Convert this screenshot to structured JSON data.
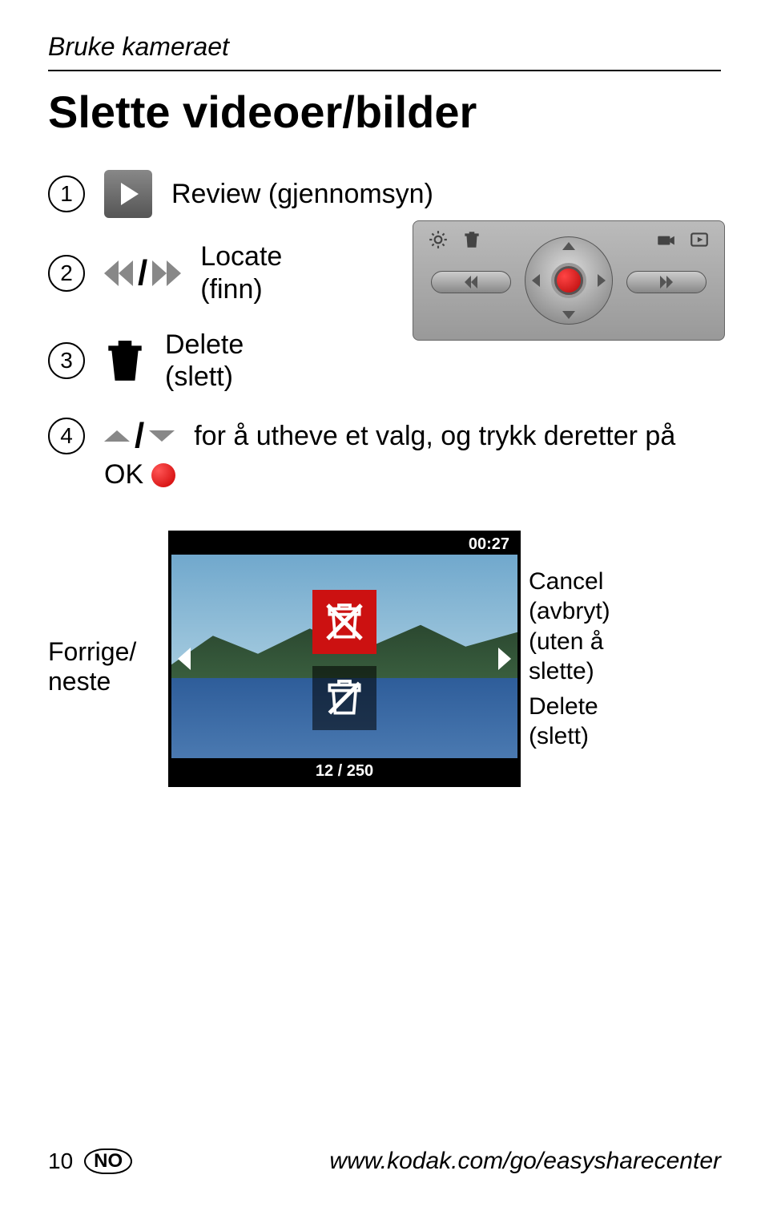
{
  "breadcrumb": "Bruke kameraet",
  "page_title": "Slette videoer/bilder",
  "steps": {
    "s1": {
      "num": "1",
      "label": "Review (gjennomsyn)"
    },
    "s2": {
      "num": "2",
      "label_line1": "Locate",
      "label_line2": "(finn)"
    },
    "s3": {
      "num": "3",
      "label_line1": "Delete",
      "label_line2": "(slett)"
    },
    "s4": {
      "num": "4",
      "label": "for å utheve et valg, og trykk deretter på",
      "ok": "OK"
    }
  },
  "screen": {
    "time": "00:27",
    "counter": "12 / 250"
  },
  "labels": {
    "prev_next_l1": "Forrige/",
    "prev_next_l2": "neste",
    "cancel_l1": "Cancel",
    "cancel_l2": "(avbryt)",
    "cancel_l3": "(uten å",
    "cancel_l4": "slette)",
    "delete_l1": "Delete",
    "delete_l2": "(slett)"
  },
  "footer": {
    "page": "10",
    "lang": "NO",
    "url": "www.kodak.com/go/easysharecenter"
  }
}
